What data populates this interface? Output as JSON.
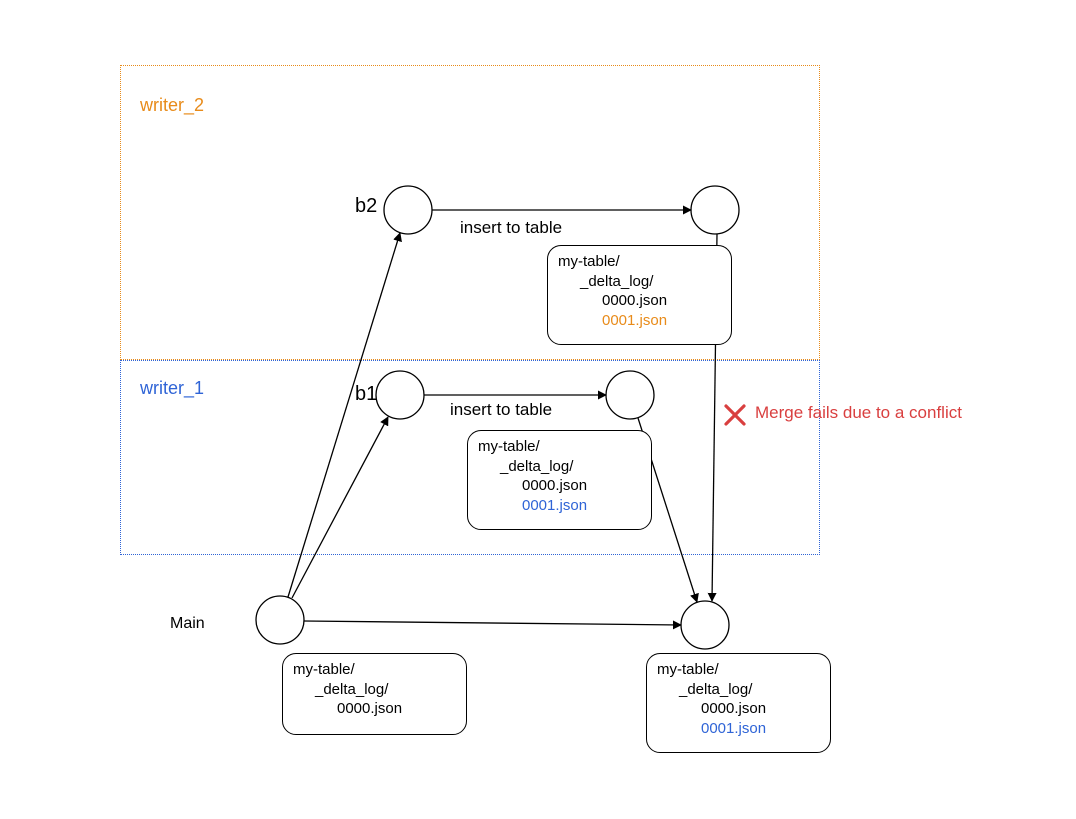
{
  "colors": {
    "orange": "#E88B1A",
    "blue": "#2F64D6",
    "red": "#D93F3F",
    "black": "#000000"
  },
  "regions": {
    "writer2": {
      "label": "writer_2"
    },
    "writer1": {
      "label": "writer_1"
    }
  },
  "main_label": "Main",
  "nodes": {
    "b1": "b1",
    "b2": "b2"
  },
  "edges": {
    "insert_b1": "insert to table",
    "insert_b2": "insert to table"
  },
  "fail_text": "Merge fails due to a conflict",
  "card_main_start": {
    "l1": "my-table/",
    "l2": "_delta_log/",
    "l3": "0000.json"
  },
  "card_b1": {
    "l1": "my-table/",
    "l2": "_delta_log/",
    "l3": "0000.json",
    "l4": "0001.json"
  },
  "card_b2": {
    "l1": "my-table/",
    "l2": "_delta_log/",
    "l3": "0000.json",
    "l4": "0001.json"
  },
  "card_main_end": {
    "l1": "my-table/",
    "l2": "_delta_log/",
    "l3": "0000.json",
    "l4": "0001.json"
  }
}
